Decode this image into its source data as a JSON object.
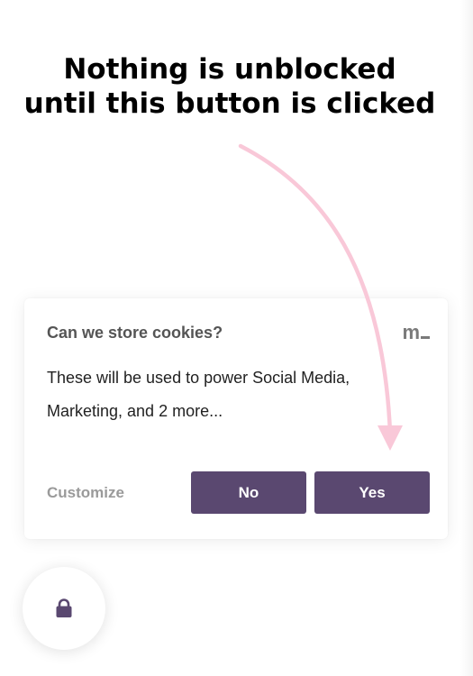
{
  "annotation": {
    "line1": "Nothing is unblocked",
    "line2": "until this button is clicked",
    "arrow_color": "#f9c8d8"
  },
  "banner": {
    "title": "Can we store cookies?",
    "brand": "m",
    "body_line1": "These will be used to power Social Media,",
    "body_line2": "Marketing, and 2 more...",
    "customize_label": "Customize",
    "no_label": "No",
    "yes_label": "Yes",
    "button_color": "#5a4870"
  },
  "fab": {
    "icon": "lock-icon",
    "icon_color": "#5a4870"
  }
}
